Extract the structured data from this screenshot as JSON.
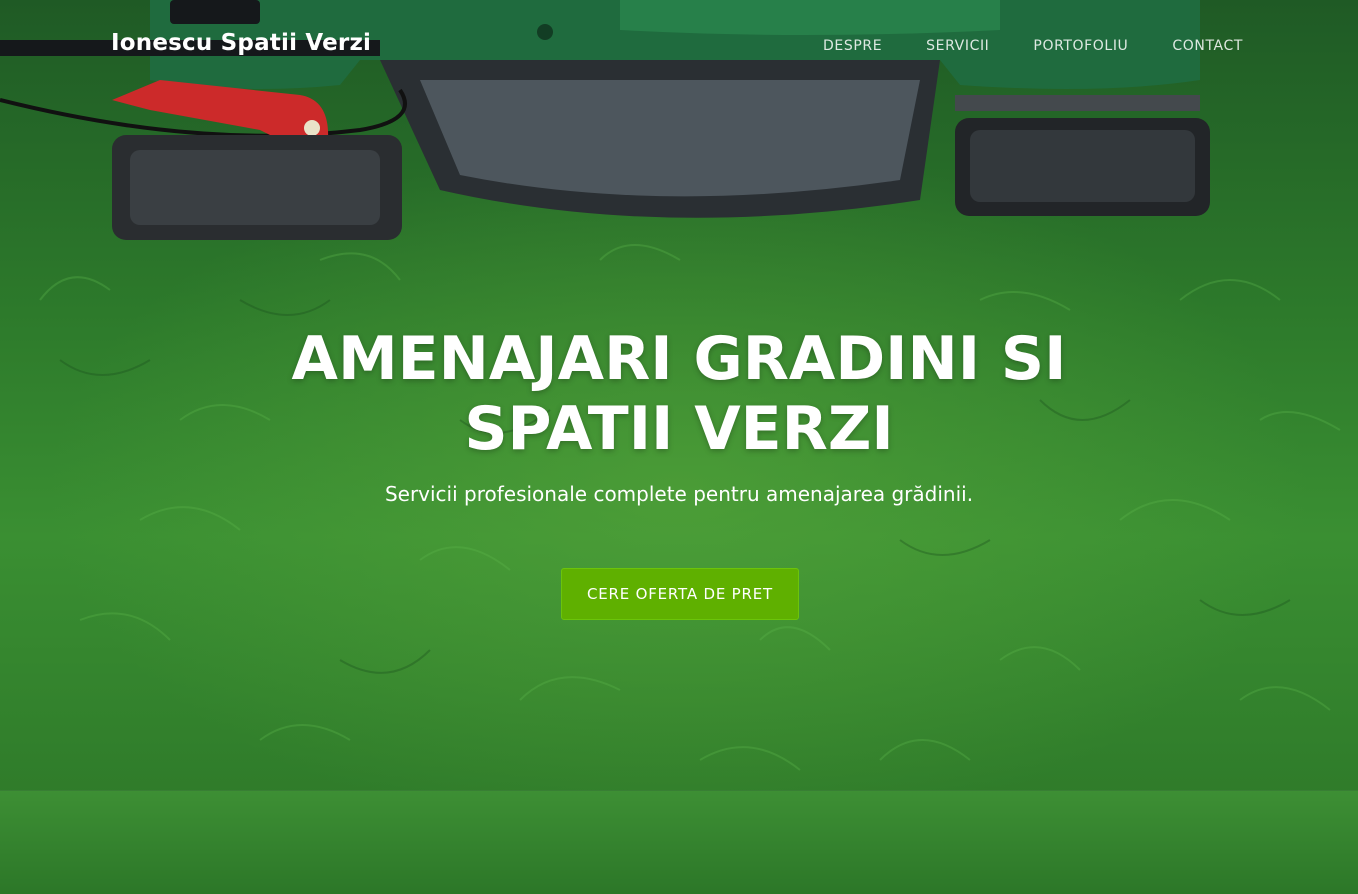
{
  "header": {
    "brand": "Ionescu Spatii Verzi",
    "nav": [
      "DESPRE",
      "SERVICII",
      "PORTOFOLIU",
      "CONTACT"
    ]
  },
  "hero": {
    "title_line1": "AMENAJARI GRADINI SI",
    "title_line2": "SPATII VERZI",
    "subtitle": "Servicii profesionale complete pentru amenajarea grădinii.",
    "cta_label": "CERE OFERTA DE PRET"
  },
  "colors": {
    "accent": "#5fb000",
    "grass": "#2f7a2a",
    "mower_body": "#1f6b3e",
    "mower_lever": "#d22a2a"
  },
  "icons": [
    "lawn-mower-illustration"
  ]
}
